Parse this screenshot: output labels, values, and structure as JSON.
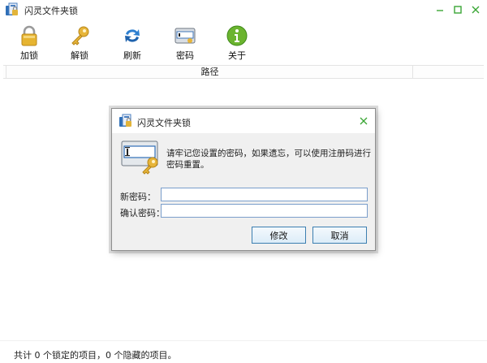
{
  "window": {
    "title": "闪灵文件夹锁"
  },
  "toolbar": {
    "items": [
      {
        "label": "加锁",
        "icon": "padlock-icon"
      },
      {
        "label": "解锁",
        "icon": "key-icon"
      },
      {
        "label": "刷新",
        "icon": "refresh-icon"
      },
      {
        "label": "密码",
        "icon": "password-card-icon"
      },
      {
        "label": "关于",
        "icon": "info-icon"
      }
    ]
  },
  "list": {
    "columns": [
      "",
      "路径",
      ""
    ]
  },
  "statusbar": {
    "text": "共计 0 个锁定的项目，0 个隐藏的项目。"
  },
  "dialog": {
    "title": "闪灵文件夹锁",
    "message": "请牢记您设置的密码，如果遗忘，可以使用注册码进行密码重置。",
    "new_password_label": "新密码：",
    "confirm_password_label": "确认密码：",
    "new_password_value": "",
    "confirm_password_value": "",
    "modify_label": "修改",
    "cancel_label": "取消"
  },
  "colors": {
    "window_control": "#3aa635",
    "dialog_panel": "#f0f0f0",
    "input_border": "#7a9ecb",
    "button_border": "#3c7fb1"
  }
}
